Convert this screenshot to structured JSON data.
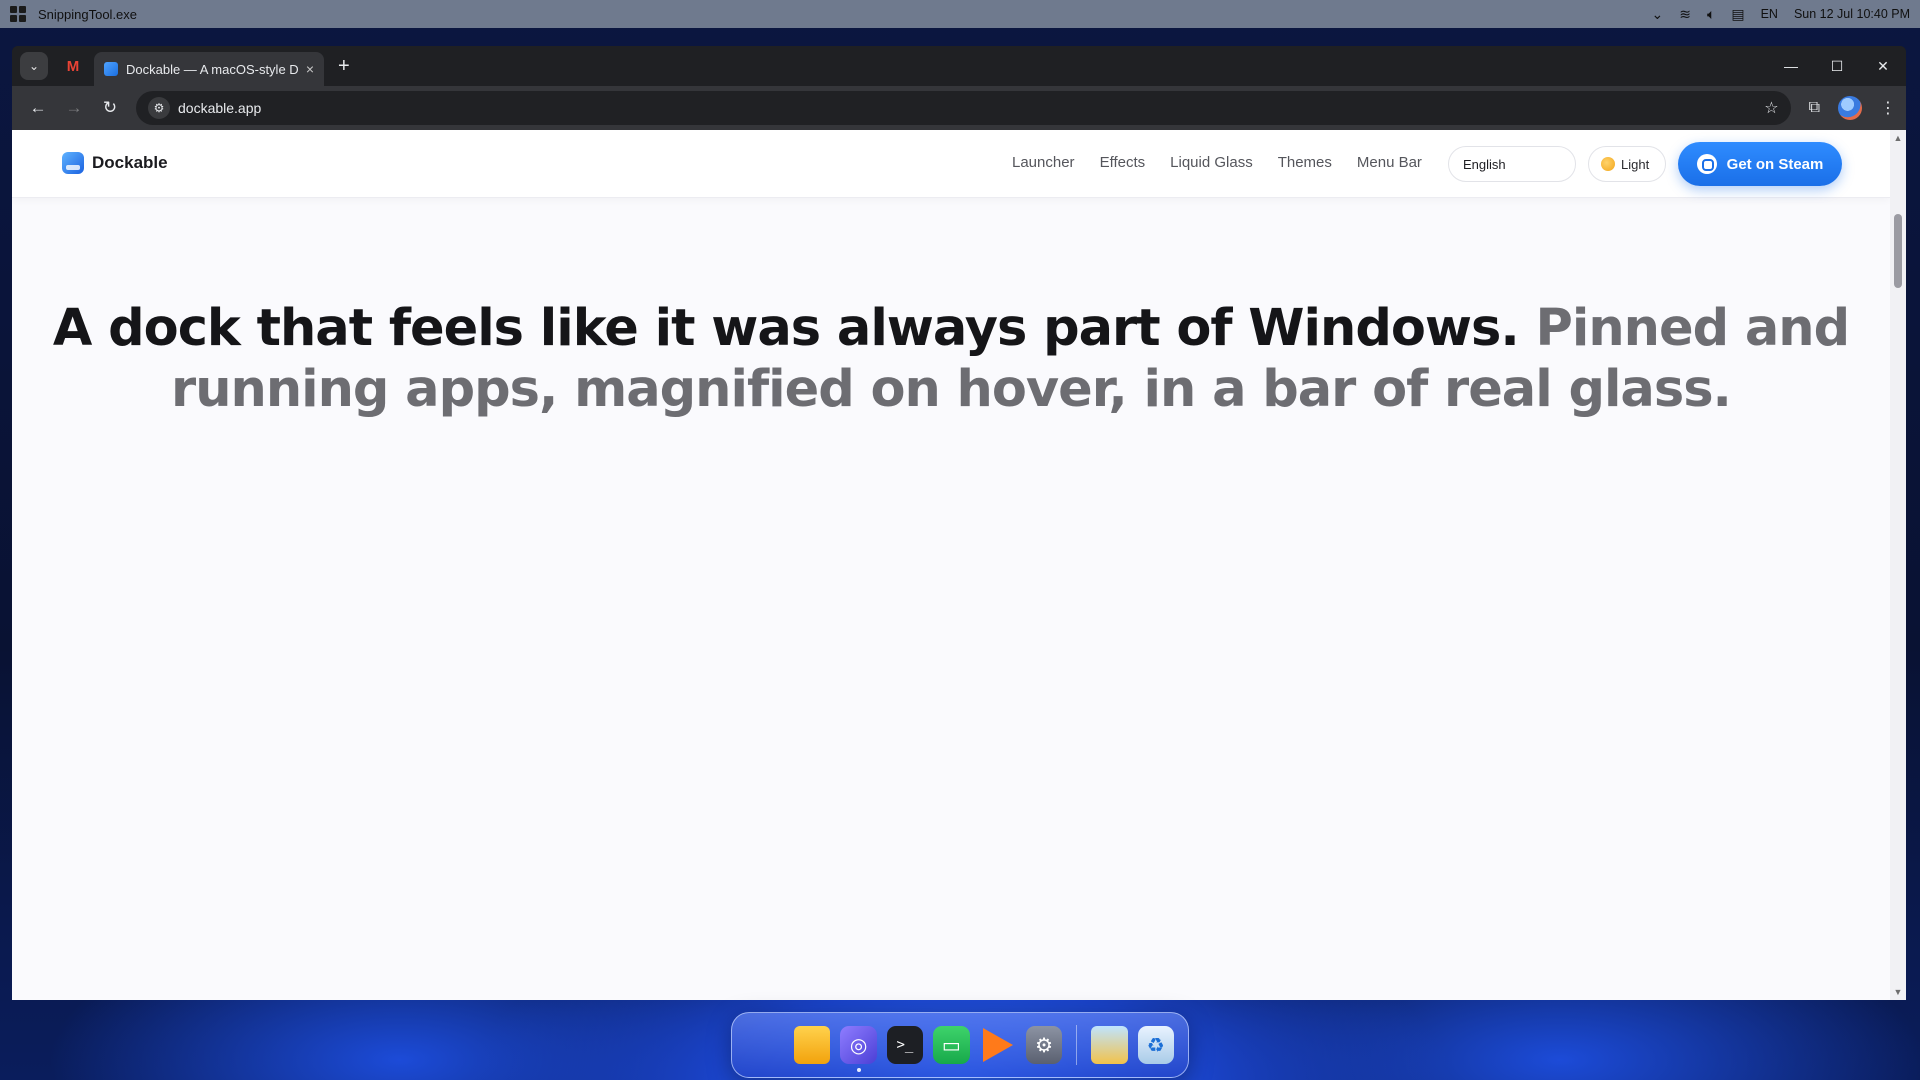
{
  "system_bar": {
    "app_title": "SnippingTool.exe",
    "language": "EN",
    "datetime": "Sun 12 Jul  10:40 PM"
  },
  "browser": {
    "tab": {
      "title": "Dockable — A macOS-style Do",
      "close_glyph": "×"
    },
    "new_tab_glyph": "+",
    "window_controls": {
      "minimize": "—",
      "maximize": "☐",
      "close": "✕"
    },
    "toolbar": {
      "back_glyph": "←",
      "forward_glyph": "→",
      "reload_glyph": "↻",
      "url": "dockable.app",
      "bookmark_glyph": "☆",
      "extensions_glyph": "⧉",
      "menu_glyph": "⋮"
    }
  },
  "site": {
    "brand": "Dockable",
    "nav": [
      "Launcher",
      "Effects",
      "Liquid Glass",
      "Themes",
      "Menu Bar"
    ],
    "language_select": "English",
    "theme_toggle": "Light",
    "cta": "Get on Steam",
    "hero": {
      "lead": "A dock that feels like it was always part of Windows.",
      "rest": "Pinned and running apps, magnified on hover, in a bar of real glass."
    }
  },
  "dock": {
    "apps": [
      "start-menu",
      "file-explorer",
      "browser",
      "terminal",
      "chat",
      "media-player",
      "settings",
      "folder",
      "recycle-bin"
    ]
  },
  "colors": {
    "accent": "#1a6fe8",
    "hero_lead": "#151518",
    "hero_rest": "#6d6d72",
    "page_bg": "#fafafd"
  }
}
